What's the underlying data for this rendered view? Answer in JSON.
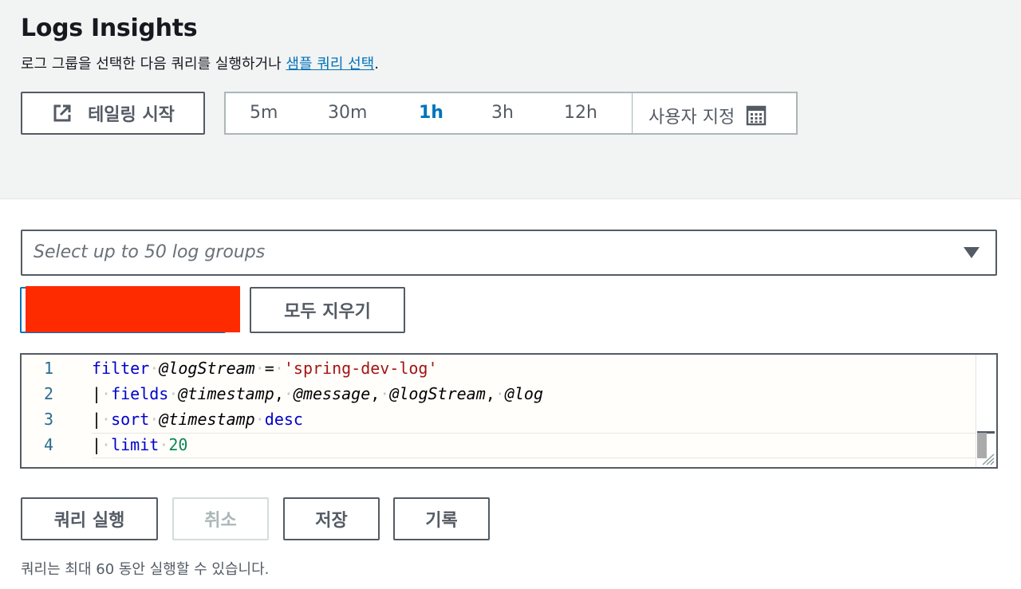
{
  "header": {
    "title": "Logs Insights",
    "subtitle_prefix": "로그 그룹을 선택한 다음 쿼리를 실행하거나 ",
    "subtitle_link": "샘플 쿼리 선택",
    "subtitle_suffix": "."
  },
  "toolbar": {
    "tail_button_label": "테일링 시작",
    "tail_icon": "external-link-icon",
    "time_ranges": [
      "5m",
      "30m",
      "1h",
      "3h",
      "12h"
    ],
    "selected_range": "1h",
    "custom_range_label": "사용자 지정",
    "custom_range_icon": "calendar-icon"
  },
  "log_group_select": {
    "placeholder": "Select up to 50 log groups"
  },
  "clear_all_label": "모두 지우기",
  "editor": {
    "line_numbers": [
      "1",
      "2",
      "3",
      "4"
    ],
    "lines": [
      "filter @logStream = 'spring-dev-log'",
      "| fields @timestamp, @message, @logStream, @log",
      "| sort @timestamp desc",
      "| limit 20"
    ]
  },
  "actions": {
    "run_label": "쿼리 실행",
    "cancel_label": "취소",
    "save_label": "저장",
    "history_label": "기록"
  },
  "footnote": "쿼리는 최대 60 동안 실행할 수 있습니다.",
  "colors": {
    "accent": "#0073bb",
    "redaction": "#ff2b00",
    "keyword": "#0000cc",
    "string": "#a31515",
    "number": "#098658"
  }
}
